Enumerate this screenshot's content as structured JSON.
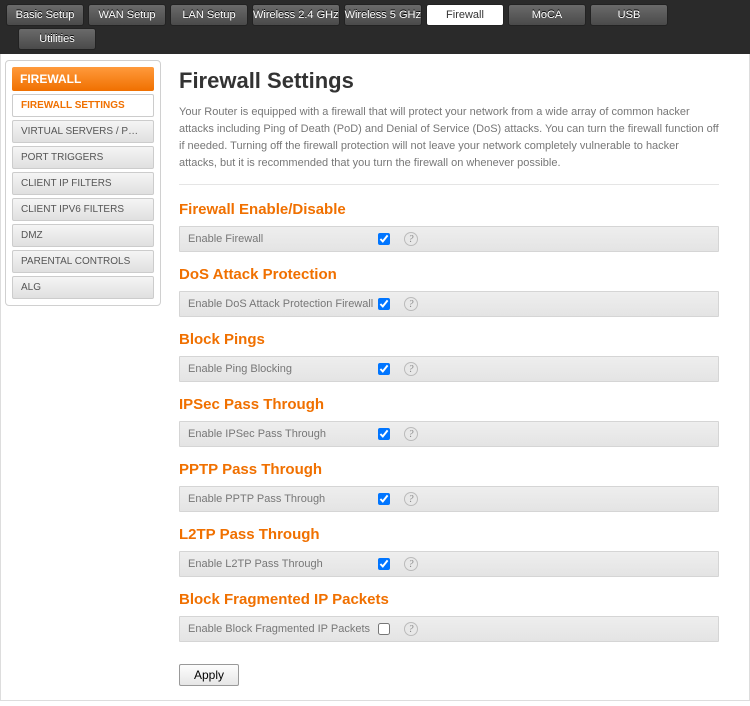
{
  "topnav": {
    "tabs": [
      "Basic Setup",
      "WAN Setup",
      "LAN Setup",
      "Wireless 2.4 GHz",
      "Wireless 5 GHz",
      "Firewall",
      "MoCA",
      "USB"
    ],
    "utilities": "Utilities"
  },
  "sidebar": {
    "header": "FIREWALL",
    "items": [
      "FIREWALL SETTINGS",
      "VIRTUAL SERVERS / PORT …",
      "PORT TRIGGERS",
      "CLIENT IP FILTERS",
      "CLIENT IPV6 FILTERS",
      "DMZ",
      "PARENTAL CONTROLS",
      "ALG"
    ]
  },
  "page": {
    "title": "Firewall Settings",
    "description": "Your Router is equipped with a firewall that will protect your network from a wide array of common hacker attacks including Ping of Death (PoD) and Denial of Service (DoS) attacks. You can turn the firewall function off if needed. Turning off the firewall protection will not leave your network completely vulnerable to hacker attacks, but it is recommended that you turn the firewall on whenever possible."
  },
  "sections": [
    {
      "title": "Firewall Enable/Disable",
      "label": "Enable Firewall",
      "checked": true
    },
    {
      "title": "DoS Attack Protection",
      "label": "Enable DoS Attack Protection Firewall",
      "checked": true
    },
    {
      "title": "Block Pings",
      "label": "Enable Ping Blocking",
      "checked": true
    },
    {
      "title": "IPSec Pass Through",
      "label": "Enable IPSec Pass Through",
      "checked": true
    },
    {
      "title": "PPTP Pass Through",
      "label": "Enable PPTP Pass Through",
      "checked": true
    },
    {
      "title": "L2TP Pass Through",
      "label": "Enable L2TP Pass Through",
      "checked": true
    },
    {
      "title": "Block Fragmented IP Packets",
      "label": "Enable Block Fragmented IP Packets",
      "checked": false
    }
  ],
  "buttons": {
    "apply": "Apply"
  },
  "help_glyph": "?"
}
